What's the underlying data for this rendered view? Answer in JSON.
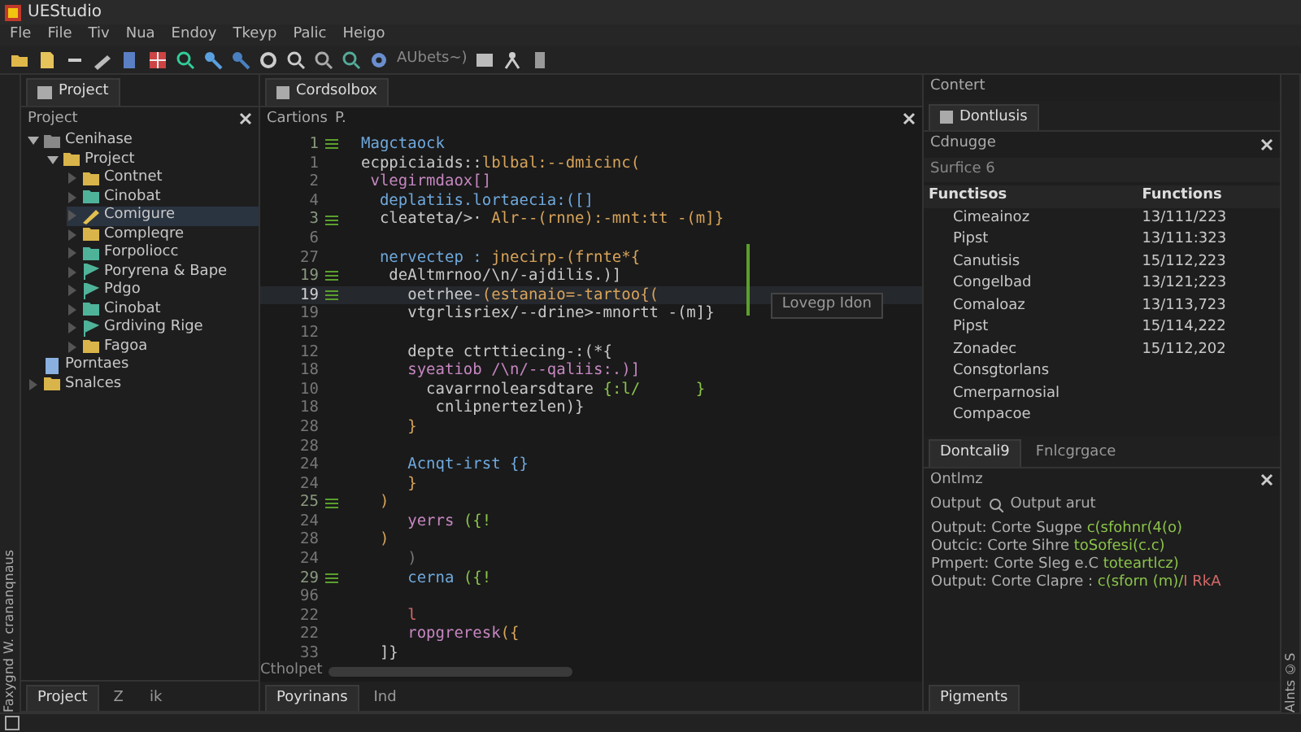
{
  "window": {
    "title": "UEStudio"
  },
  "menu": [
    "Fle",
    "File",
    "Tiv",
    "Nua",
    "Endoy",
    "Tkeyp",
    "Palic",
    "Heigo"
  ],
  "toolbar": {
    "text": "AUbets~)"
  },
  "left_strip": {
    "label": "Faxygnd W. crananqnaus"
  },
  "project_panel": {
    "tab": "Project",
    "header": "Project",
    "tree": [
      {
        "label": "Cenihase",
        "kind": "project",
        "expanded": true,
        "selected": false,
        "children": [
          {
            "label": "Project",
            "kind": "folder",
            "expanded": true,
            "selected": false,
            "children": [
              {
                "label": "Contnet",
                "kind": "folder",
                "expanded": false,
                "selected": false
              },
              {
                "label": "Cinobat",
                "kind": "teal",
                "expanded": false,
                "selected": false
              },
              {
                "label": "Comigure",
                "kind": "pencil",
                "expanded": false,
                "selected": true
              },
              {
                "label": "Compleqre",
                "kind": "folder",
                "expanded": false,
                "selected": false
              },
              {
                "label": "Forpoliocc",
                "kind": "teal",
                "expanded": false,
                "selected": false
              },
              {
                "label": "Poryrena & Bape",
                "kind": "flag",
                "expanded": false,
                "selected": false
              },
              {
                "label": "Pdgo",
                "kind": "flag",
                "expanded": false,
                "selected": false
              },
              {
                "label": "Cinobat",
                "kind": "teal",
                "expanded": false,
                "selected": false
              },
              {
                "label": "Grdiving Rige",
                "kind": "flag",
                "expanded": false,
                "selected": false
              },
              {
                "label": "Fagoa",
                "kind": "folder",
                "expanded": false,
                "selected": false
              }
            ]
          }
        ]
      },
      {
        "label": "Porntaes",
        "kind": "file",
        "selected": false
      },
      {
        "label": "Snalces",
        "kind": "folder",
        "expanded": false,
        "selected": false
      }
    ],
    "bottom_tabs": [
      {
        "label": "Project",
        "selected": true
      },
      {
        "label": "Z",
        "selected": false
      },
      {
        "label": "ik",
        "selected": false
      }
    ]
  },
  "editor": {
    "tab": "Cordsolbox",
    "breadcrumb": "Cartions",
    "breadcrumb_2": "P.",
    "hint": "Lovegp Idon",
    "scroll_label": "Ctholpet",
    "lines": [
      {
        "number": "1",
        "marker": true,
        "current": false,
        "tokens": [
          {
            "text": "Magctaock",
            "color": "#6fa8dc"
          }
        ]
      },
      {
        "number": "1",
        "marker": false,
        "current": false,
        "tokens": [
          {
            "text": "ecppiciaids::",
            "color": "#c8c8c8"
          },
          {
            "text": "lblbal:--dmicinc(",
            "color": "#d7a35a"
          }
        ]
      },
      {
        "number": "2",
        "marker": false,
        "current": false,
        "tokens": [
          {
            "text": " vlegirmdaox[]",
            "color": "#c586c0"
          }
        ]
      },
      {
        "number": "4",
        "marker": false,
        "current": false,
        "tokens": [
          {
            "text": "  deplatiis.lortaecia:([]",
            "color": "#6fa8dc"
          }
        ]
      },
      {
        "number": "3",
        "marker": true,
        "current": false,
        "tokens": [
          {
            "text": "  cleateta/>· ",
            "color": "#c8c8c8"
          },
          {
            "text": "Alr--(rnne):-mnt:tt -(m]}",
            "color": "#d7a35a"
          }
        ]
      },
      {
        "number": "6",
        "marker": false,
        "current": false
      },
      {
        "number": "27",
        "marker": false,
        "current": false,
        "tokens": [
          {
            "text": "  nervectep : ",
            "color": "#6fa8dc"
          },
          {
            "text": "jnecirp-(frnte*{",
            "color": "#d7a35a"
          }
        ]
      },
      {
        "number": "19",
        "marker": true,
        "current": false,
        "tokens": [
          {
            "text": "   deAltmrnoo/\\n/-ajdilis.)]",
            "color": "#c8c8c8"
          }
        ]
      },
      {
        "number": "19",
        "marker": true,
        "current": true,
        "tokens": [
          {
            "text": "     oetrhee-",
            "color": "#c8c8c8"
          },
          {
            "text": "(estanaio=-tartoo{(",
            "color": "#d7a35a"
          }
        ]
      },
      {
        "number": "19",
        "marker": false,
        "current": false,
        "tokens": [
          {
            "text": "     vtgrlisriex/--drine>-mnortt -(m]}",
            "color": "#c8c8c8"
          }
        ]
      },
      {
        "number": "12",
        "marker": false,
        "current": false
      },
      {
        "number": "12",
        "marker": false,
        "current": false,
        "tokens": [
          {
            "text": "     depte ctrttiecing-:(*{",
            "color": "#c8c8c8"
          }
        ]
      },
      {
        "number": "18",
        "marker": false,
        "current": false,
        "tokens": [
          {
            "text": "     syeatiob /\\n/--qaliis:.)]",
            "color": "#c586c0"
          }
        ]
      },
      {
        "number": "10",
        "marker": false,
        "current": false,
        "tokens": [
          {
            "text": "       cavarrnolearsdtare ",
            "color": "#c8c8c8"
          },
          {
            "text": "{:l/      }",
            "color": "#8bc34a"
          }
        ]
      },
      {
        "number": "18",
        "marker": false,
        "current": false,
        "tokens": [
          {
            "text": "        cnlipnertezlen)}",
            "color": "#c8c8c8"
          }
        ]
      },
      {
        "number": "28",
        "marker": false,
        "current": false,
        "tokens": [
          {
            "text": "     }",
            "color": "#d7a35a"
          }
        ]
      },
      {
        "number": "28",
        "marker": false,
        "current": false
      },
      {
        "number": "24",
        "marker": false,
        "current": false,
        "tokens": [
          {
            "text": "     Acnqt-irst {}",
            "color": "#6fa8dc"
          }
        ]
      },
      {
        "number": "24",
        "marker": false,
        "current": false,
        "tokens": [
          {
            "text": "     }",
            "color": "#d7a35a"
          }
        ]
      },
      {
        "number": "25",
        "marker": true,
        "current": false,
        "tokens": [
          {
            "text": "  )",
            "color": "#d7a35a"
          }
        ]
      },
      {
        "number": "24",
        "marker": false,
        "current": false,
        "tokens": [
          {
            "text": "     yerrs ",
            "color": "#c586c0"
          },
          {
            "text": "({!",
            "color": "#8bc34a"
          }
        ]
      },
      {
        "number": "28",
        "marker": false,
        "current": false,
        "tokens": [
          {
            "text": "  )",
            "color": "#d7a35a"
          }
        ]
      },
      {
        "number": "24",
        "marker": false,
        "current": false,
        "tokens": [
          {
            "text": "     )",
            "color": "#777777"
          }
        ]
      },
      {
        "number": "29",
        "marker": true,
        "current": false,
        "tokens": [
          {
            "text": "     cerna ",
            "color": "#6fa8dc"
          },
          {
            "text": "({!",
            "color": "#8bc34a"
          }
        ]
      },
      {
        "number": "96",
        "marker": false,
        "current": false
      },
      {
        "number": "22",
        "marker": false,
        "current": false,
        "tokens": [
          {
            "text": "     l",
            "color": "#d16969"
          }
        ]
      },
      {
        "number": "22",
        "marker": false,
        "current": false,
        "tokens": [
          {
            "text": "     ropgreresk",
            "color": "#c586c0"
          },
          {
            "text": "({",
            "color": "#d7a35a"
          }
        ]
      },
      {
        "number": "33",
        "marker": false,
        "current": false,
        "tokens": [
          {
            "text": "  ]}",
            "color": "#c8c8c8"
          }
        ]
      }
    ],
    "bottom_tabs": [
      {
        "label": "Poyrinans",
        "selected": true
      },
      {
        "label": "Ind",
        "selected": false
      }
    ]
  },
  "right_strip": {
    "label": "Alnts ©S"
  },
  "functions_panel": {
    "header": "Contert",
    "tab": "Dontlusis",
    "title": "Cdnugge",
    "search": {
      "placeholder": "Surfice 6"
    },
    "columns": [
      "Functisos",
      "Functions"
    ],
    "rows": [
      [
        "Cimeainoz",
        "13/111/223"
      ],
      [
        "Pipst",
        "13/111:323"
      ],
      [
        "Canutisis",
        "15/112,223"
      ],
      [
        "Congelbad",
        "13/121;223"
      ],
      [
        "Comaloaz",
        "13/113,723"
      ],
      [
        "Pipst",
        "15/114,222"
      ],
      [
        "Zonadec",
        "15/112,202"
      ],
      [
        "Consgtorlans",
        ""
      ],
      [
        "Cmerparnosial",
        ""
      ],
      [
        "Compacoe",
        ""
      ]
    ]
  },
  "output_panel": {
    "tabs": [
      {
        "label": "Dontcali9",
        "selected": true
      },
      {
        "label": "Fnlcgrgace",
        "selected": false
      }
    ],
    "title": "Ontlmz",
    "filter_label": "Output",
    "filter_value": "Output arut",
    "lines": [
      {
        "tokens": [
          {
            "text": "Output: Corte Sugpe ",
            "color": "#b0b0b0"
          },
          {
            "text": "c(sfohnr(4(o)",
            "color": "#8bc34a"
          }
        ]
      },
      {
        "tokens": [
          {
            "text": "Outcic: Corte Sihre ",
            "color": "#b0b0b0"
          },
          {
            "text": "toSofesi(c.c)",
            "color": "#8bc34a"
          }
        ]
      },
      {
        "tokens": [
          {
            "text": "Pmpert: Corte Sleg e.C ",
            "color": "#b0b0b0"
          },
          {
            "text": "toteartlcz)",
            "color": "#8bc34a"
          }
        ]
      },
      {
        "tokens": [
          {
            "text": "Output: Corte Clapre : ",
            "color": "#b0b0b0"
          },
          {
            "text": "c(sforn (m)/",
            "color": "#8bc34a"
          },
          {
            "text": "I RkA",
            "color": "#d16969"
          }
        ]
      }
    ],
    "bottom_tab": "Pigments"
  }
}
